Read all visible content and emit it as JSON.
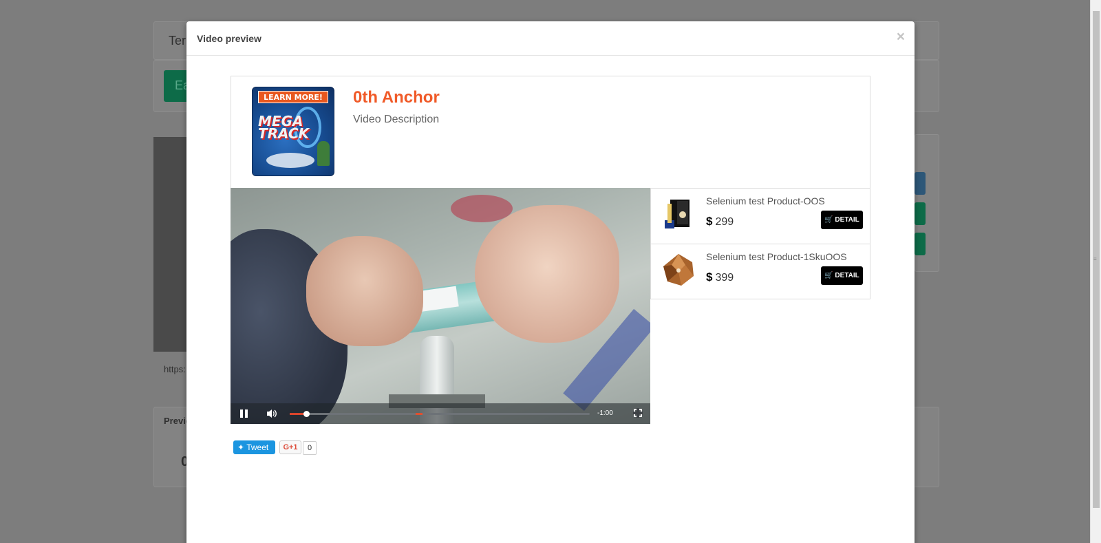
{
  "background": {
    "panel_text": "Ter",
    "green_button_text": "Ea",
    "url_text": "https:",
    "preview_label": "Previe",
    "preview_field_char": "0"
  },
  "modal": {
    "title": "Video preview",
    "close_glyph": "×"
  },
  "anchor": {
    "title": "0th Anchor",
    "description": "Video Description",
    "thumbnail": {
      "banner": "LEARN MORE!",
      "brand_line1": "MEGA",
      "brand_line2": "TRACK"
    }
  },
  "video_controls": {
    "time_remaining": "-1:00",
    "progress_fraction": 0.055,
    "buffered_fraction": 0.42
  },
  "products": [
    {
      "name": "Selenium test Product-OOS",
      "currency": "$",
      "price": "299",
      "button": "DETAIL",
      "icon": "cart-icon"
    },
    {
      "name": "Selenium test Product-1SkuOOS",
      "currency": "$",
      "price": "399",
      "button": "DETAIL",
      "icon": "cart-icon"
    }
  ],
  "share": {
    "tweet_label": "Tweet",
    "gplus_label": "G+1",
    "gplus_count": "0"
  },
  "colors": {
    "anchor_title": "#f05a28",
    "tweet": "#1b95e0",
    "detail_button": "#000000"
  }
}
